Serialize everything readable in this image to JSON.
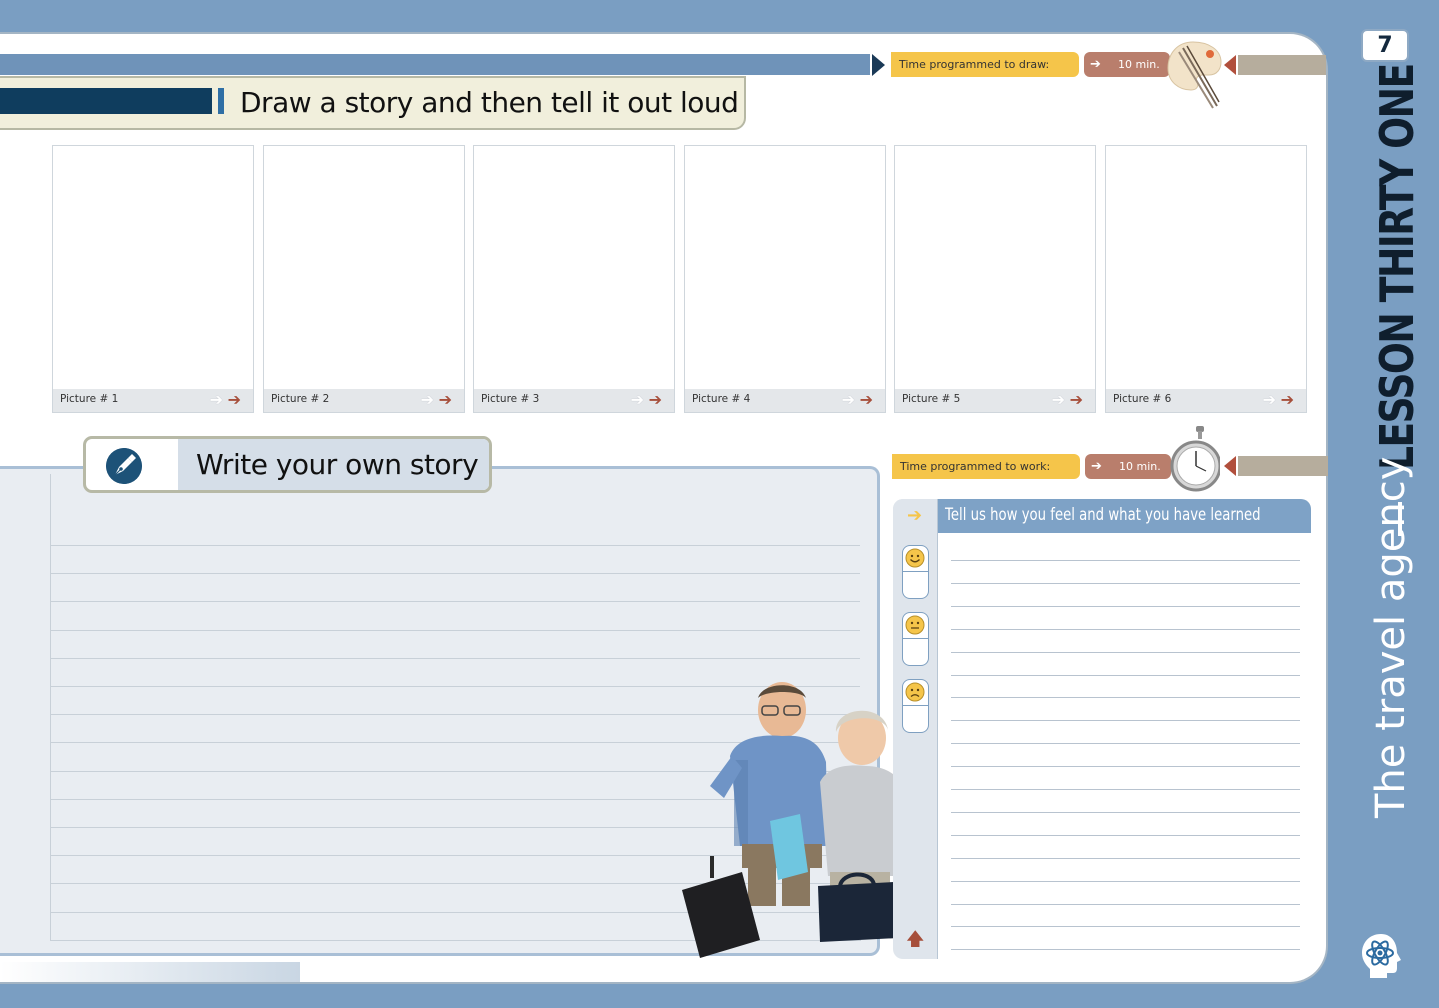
{
  "page_number": "7",
  "lesson_title": "LESSON THIRTY ONE",
  "lesson_subtitle": "The travel agency",
  "draw_section": {
    "title": "Draw a story and then tell it out loud",
    "time_label": "Time programmed to draw:",
    "time_value": "10 min.",
    "pictures": [
      "Picture # 1",
      "Picture # 2",
      "Picture # 3",
      "Picture  # 4",
      "Picture # 5",
      "Picture # 6"
    ]
  },
  "story_section": {
    "title": "Write your own story"
  },
  "feedback_section": {
    "time_label": "Time programmed to work:",
    "time_value": "10 min.",
    "title": "Tell us how you feel and what you have learned"
  },
  "icons": {
    "arrow_right": "arrow-right-icon",
    "palette": "palette-icon",
    "stopwatch": "stopwatch-icon",
    "pen": "pen-icon",
    "atom": "atom-head-icon"
  },
  "colors": {
    "background": "#7a9ec2",
    "accent_yellow": "#f5c54a",
    "accent_rust": "#b97e6c",
    "navy": "#0f3d5e"
  }
}
